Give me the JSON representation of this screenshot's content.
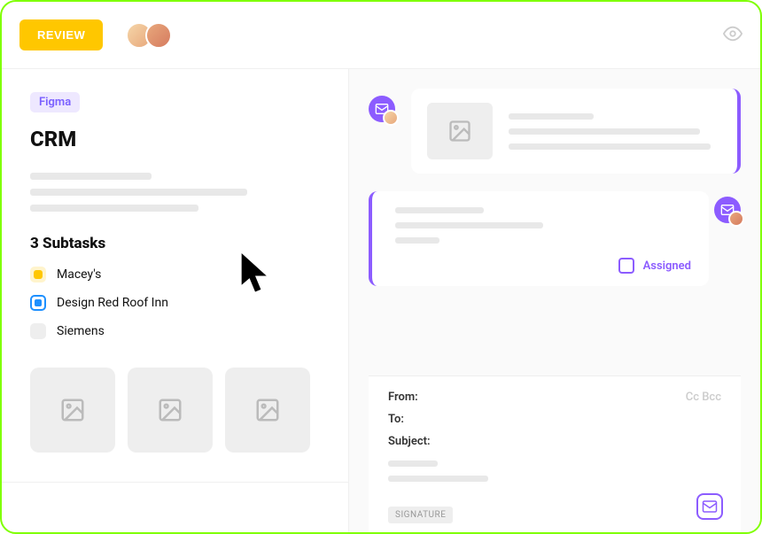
{
  "topbar": {
    "review_label": "REVIEW",
    "avatars": [
      "avatar1",
      "avatar2"
    ]
  },
  "left": {
    "tag": "Figma",
    "title": "CRM",
    "subtasks_heading": "3 Subtasks",
    "subtasks": [
      {
        "label": "Macey's",
        "color": "yellow"
      },
      {
        "label": "Design Red Roof Inn",
        "color": "blue"
      },
      {
        "label": "Siemens",
        "color": "gray"
      }
    ]
  },
  "right": {
    "assigned_label": "Assigned"
  },
  "compose": {
    "from_label": "From:",
    "to_label": "To:",
    "subject_label": "Subject:",
    "cc_label": "Cc",
    "bcc_label": "Bcc",
    "signature_label": "SIGNATURE"
  }
}
